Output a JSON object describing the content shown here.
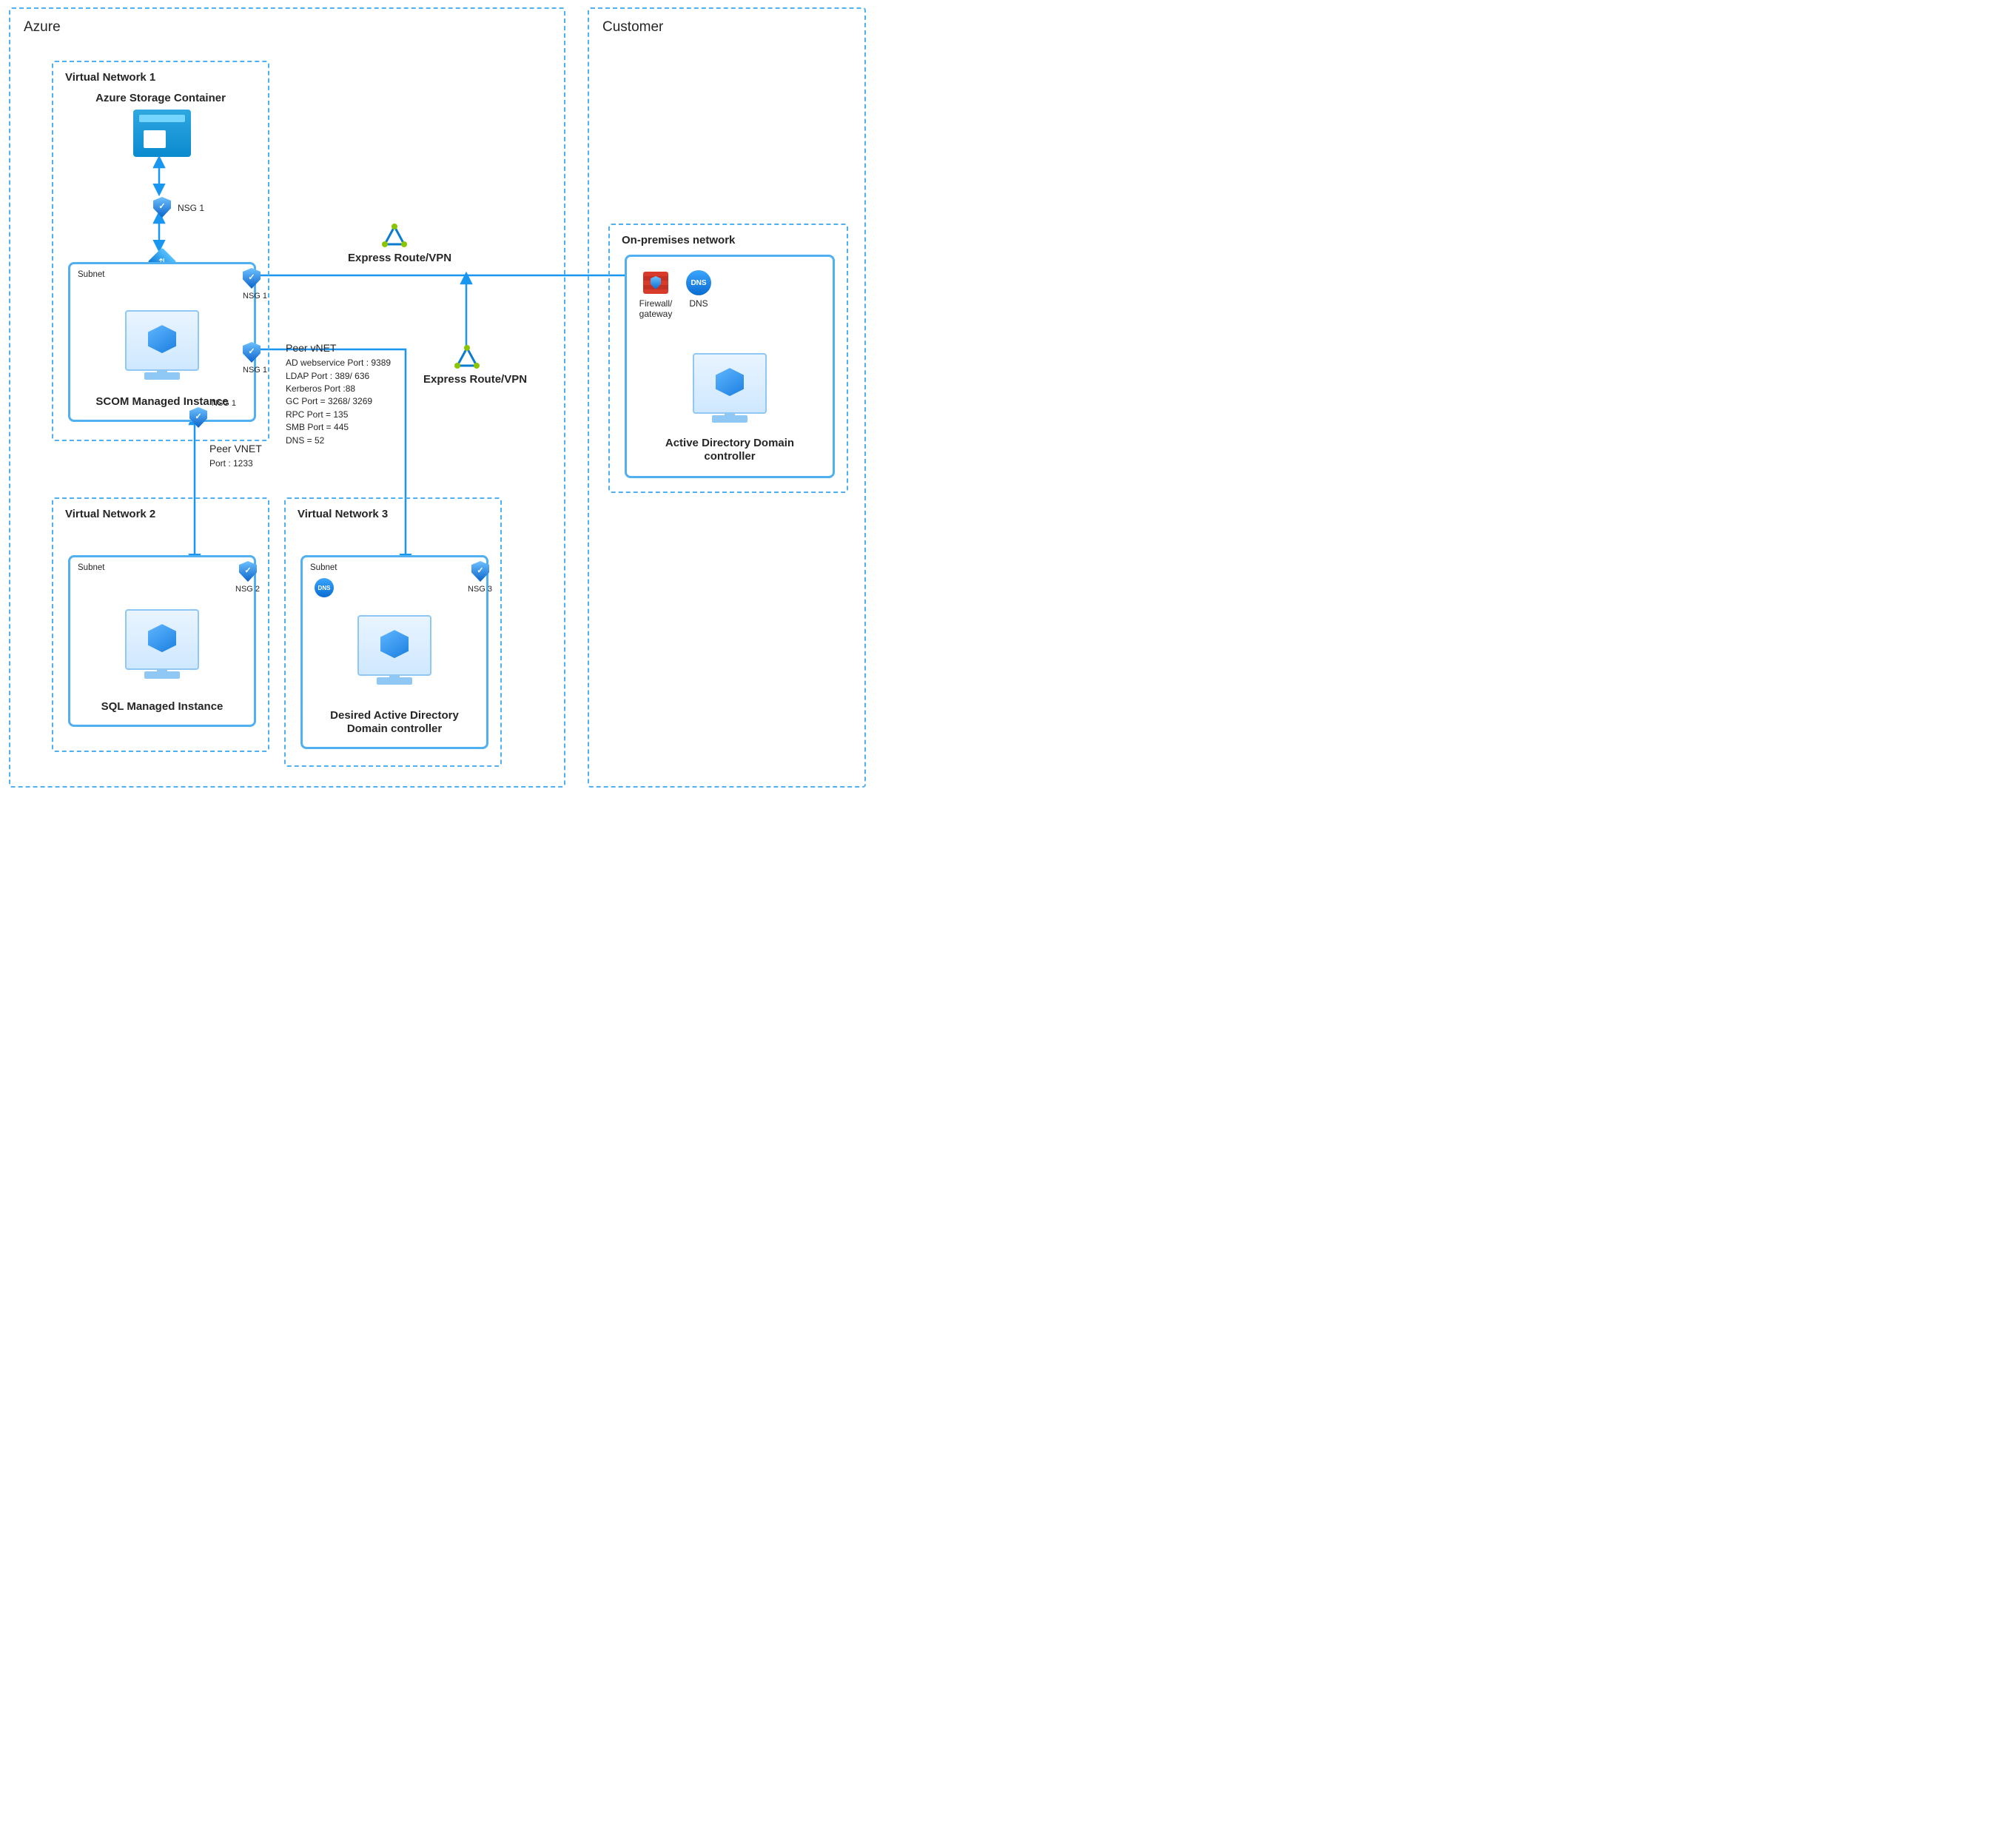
{
  "regions": {
    "azure": {
      "title": "Azure"
    },
    "customer": {
      "title": "Customer"
    }
  },
  "vnets": {
    "v1": {
      "title": "Virtual Network 1",
      "storage_title": "Azure Storage Container",
      "nat_label": "NAT Gateway",
      "subnet_label": "Subnet",
      "scom_title": "SCOM Managed Instance"
    },
    "v2": {
      "title": "Virtual Network 2",
      "subnet_label": "Subnet",
      "sql_title": "SQL Managed Instance"
    },
    "v3": {
      "title": "Virtual Network 3",
      "subnet_label": "Subnet",
      "adc_title": "Desired Active Directory Domain controller"
    }
  },
  "onprem": {
    "title": "On-premises network",
    "firewall_label": "Firewall/\ngateway",
    "dns_label": "DNS",
    "adc_title": "Active Directory Domain controller"
  },
  "nsg": {
    "nsg1": "NSG 1",
    "nsg2": "NSG 2",
    "nsg3": "NSG 3"
  },
  "express": {
    "top": "Express Route/VPN",
    "mid": "Express Route/VPN"
  },
  "peer": {
    "v1v2_title": "Peer VNET",
    "v1v2_port": "Port : 1233",
    "v1v3_title": "Peer vNET",
    "v1v3_lines": [
      "AD webservice Port : 9389",
      "LDAP Port : 389/ 636",
      "Kerberos Port :88",
      "GC Port = 3268/ 3269",
      "RPC Port = 135",
      "SMB Port = 445",
      "DNS = 52"
    ]
  }
}
